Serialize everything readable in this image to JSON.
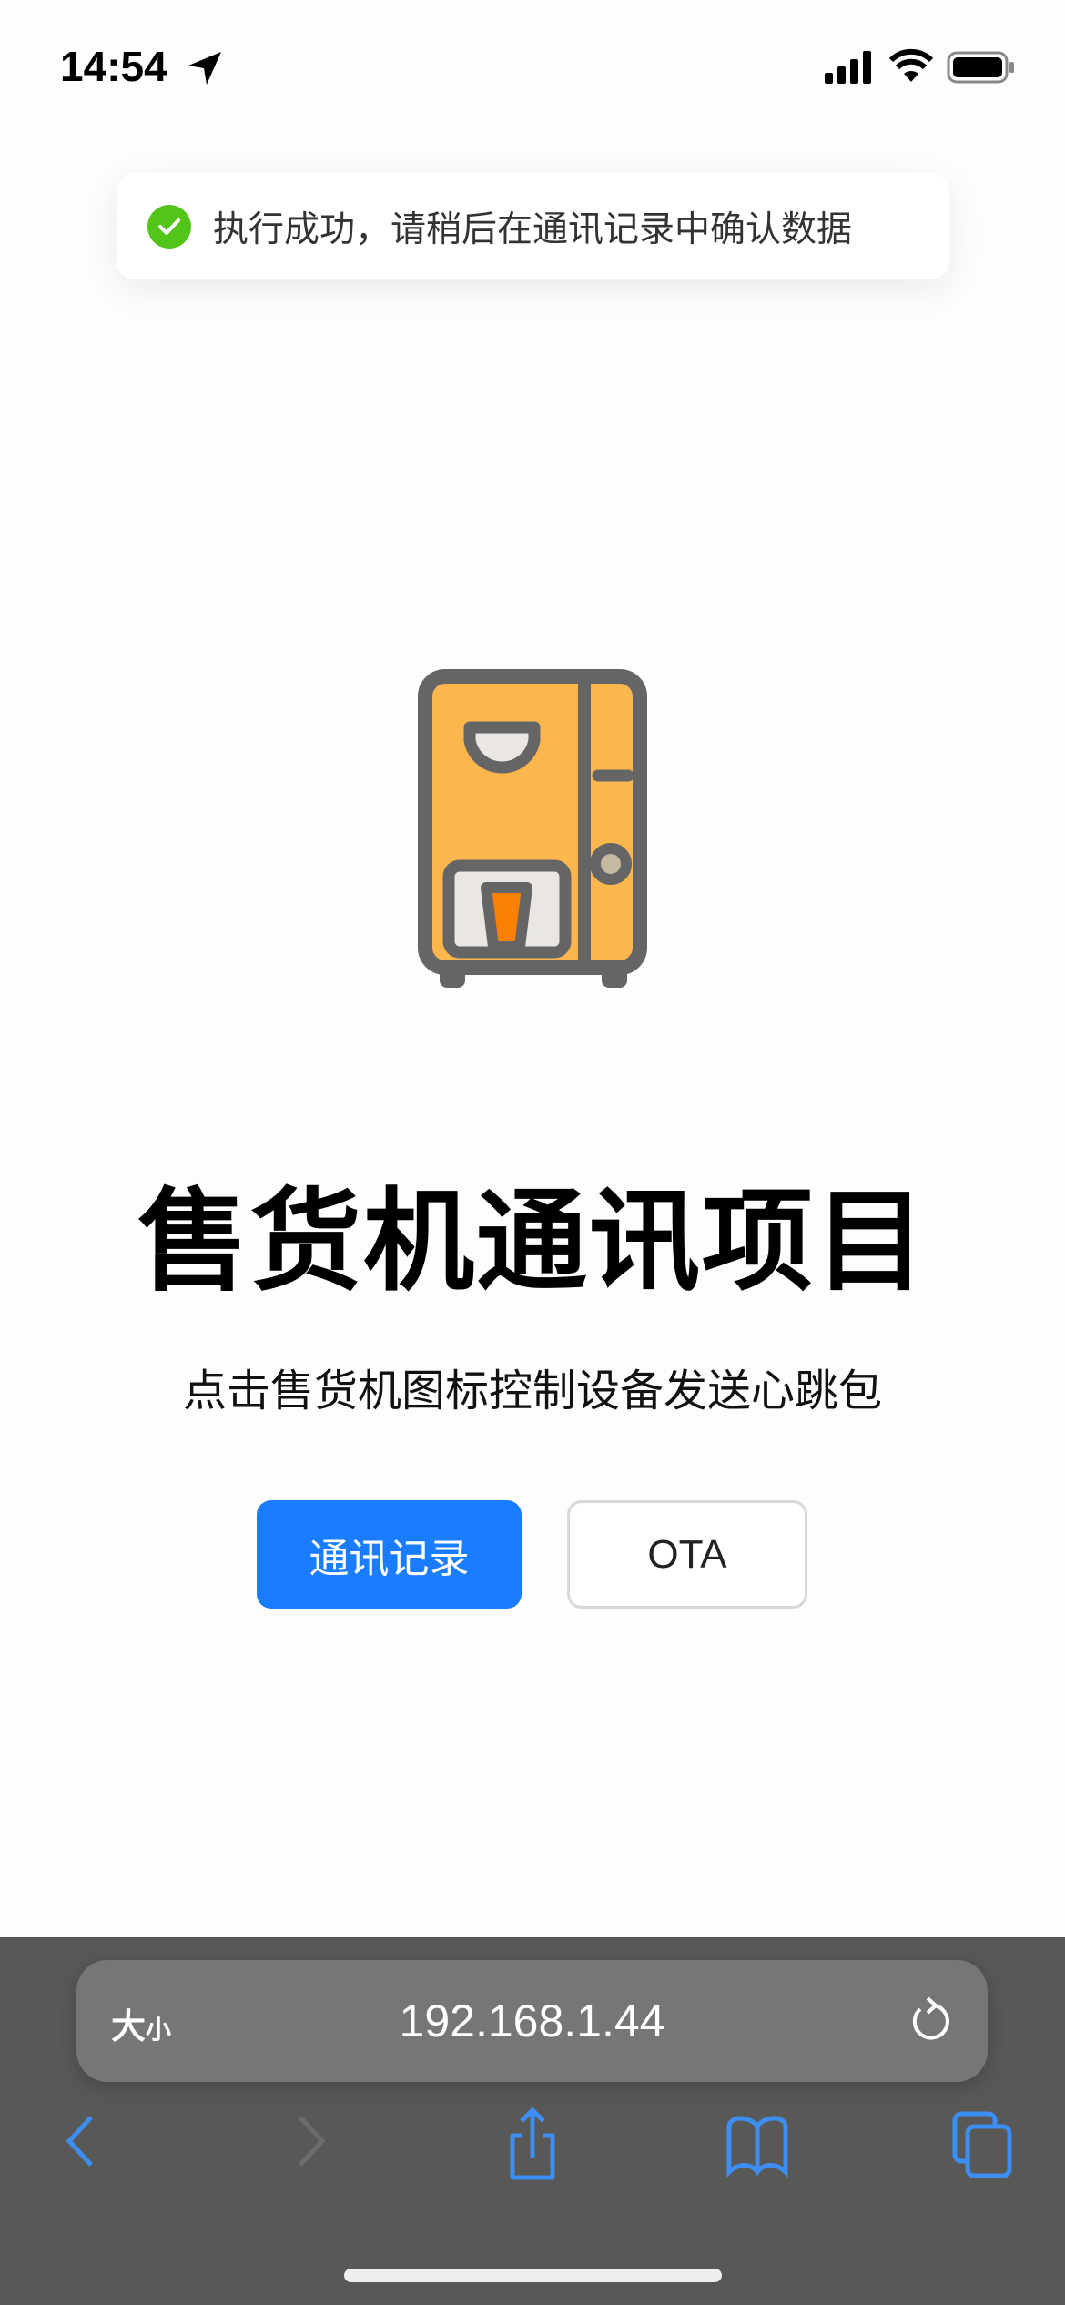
{
  "status_bar": {
    "time": "14:54"
  },
  "toast": {
    "icon": "check-circle-icon",
    "message": "执行成功，请稍后在通讯记录中确认数据",
    "color": "#52c41a"
  },
  "main": {
    "icon": "vending-machine-icon",
    "title": "售货机通讯项目",
    "subtitle": "点击售货机图标控制设备发送心跳包",
    "buttons": {
      "records": "通讯记录",
      "ota": "OTA"
    },
    "accent": "#1a7cff"
  },
  "browser": {
    "text_size_big": "大",
    "text_size_small": "小",
    "url": "192.168.1.44"
  }
}
